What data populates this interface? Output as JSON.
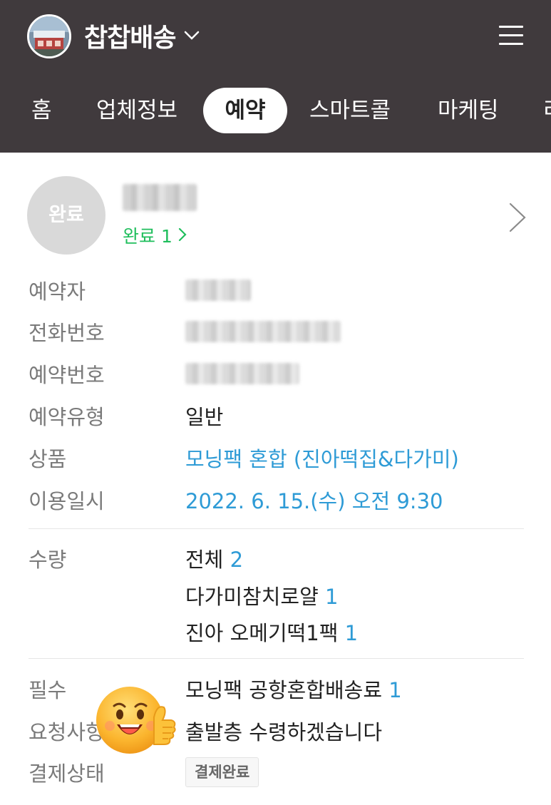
{
  "header": {
    "store_name": "찹찹배송",
    "tabs": [
      "홈",
      "업체정보",
      "예약",
      "스마트콜",
      "마케팅",
      "리"
    ],
    "active_tab": "예약",
    "background": "#403a3d"
  },
  "reservation": {
    "status_circle": "완료",
    "completed_link": "완료 1",
    "fields": {
      "booker_label": "예약자",
      "phone_label": "전화번호",
      "number_label": "예약번호",
      "type_label": "예약유형",
      "type_value": "일반",
      "product_label": "상품",
      "product_value": "모닝팩 혼합 (진아떡집&다가미)",
      "datetime_label": "이용일시",
      "datetime_value": "2022. 6. 15.(수) 오전 9:30"
    },
    "quantity": {
      "label": "수량",
      "items": [
        {
          "name": "전체",
          "count": "2"
        },
        {
          "name": "다가미참치로얄",
          "count": "1"
        },
        {
          "name": "진아 오메기떡1팩",
          "count": "1"
        }
      ]
    },
    "required": {
      "label": "필수",
      "name": "모닝팩 공항혼합배송료",
      "count": "1"
    },
    "request": {
      "label": "요청사항",
      "value": "출발층 수령하겠습니다"
    },
    "payment": {
      "label": "결제상태",
      "badge": "결제완료"
    }
  },
  "colors": {
    "accent_green": "#1fbe5c",
    "link_blue": "#2e9bd6",
    "label_gray": "#7a7a7a"
  },
  "icons": [
    "chevron-down-icon",
    "hamburger-menu-icon",
    "chevron-right-icon",
    "thumbs-up-emoji-icon"
  ]
}
